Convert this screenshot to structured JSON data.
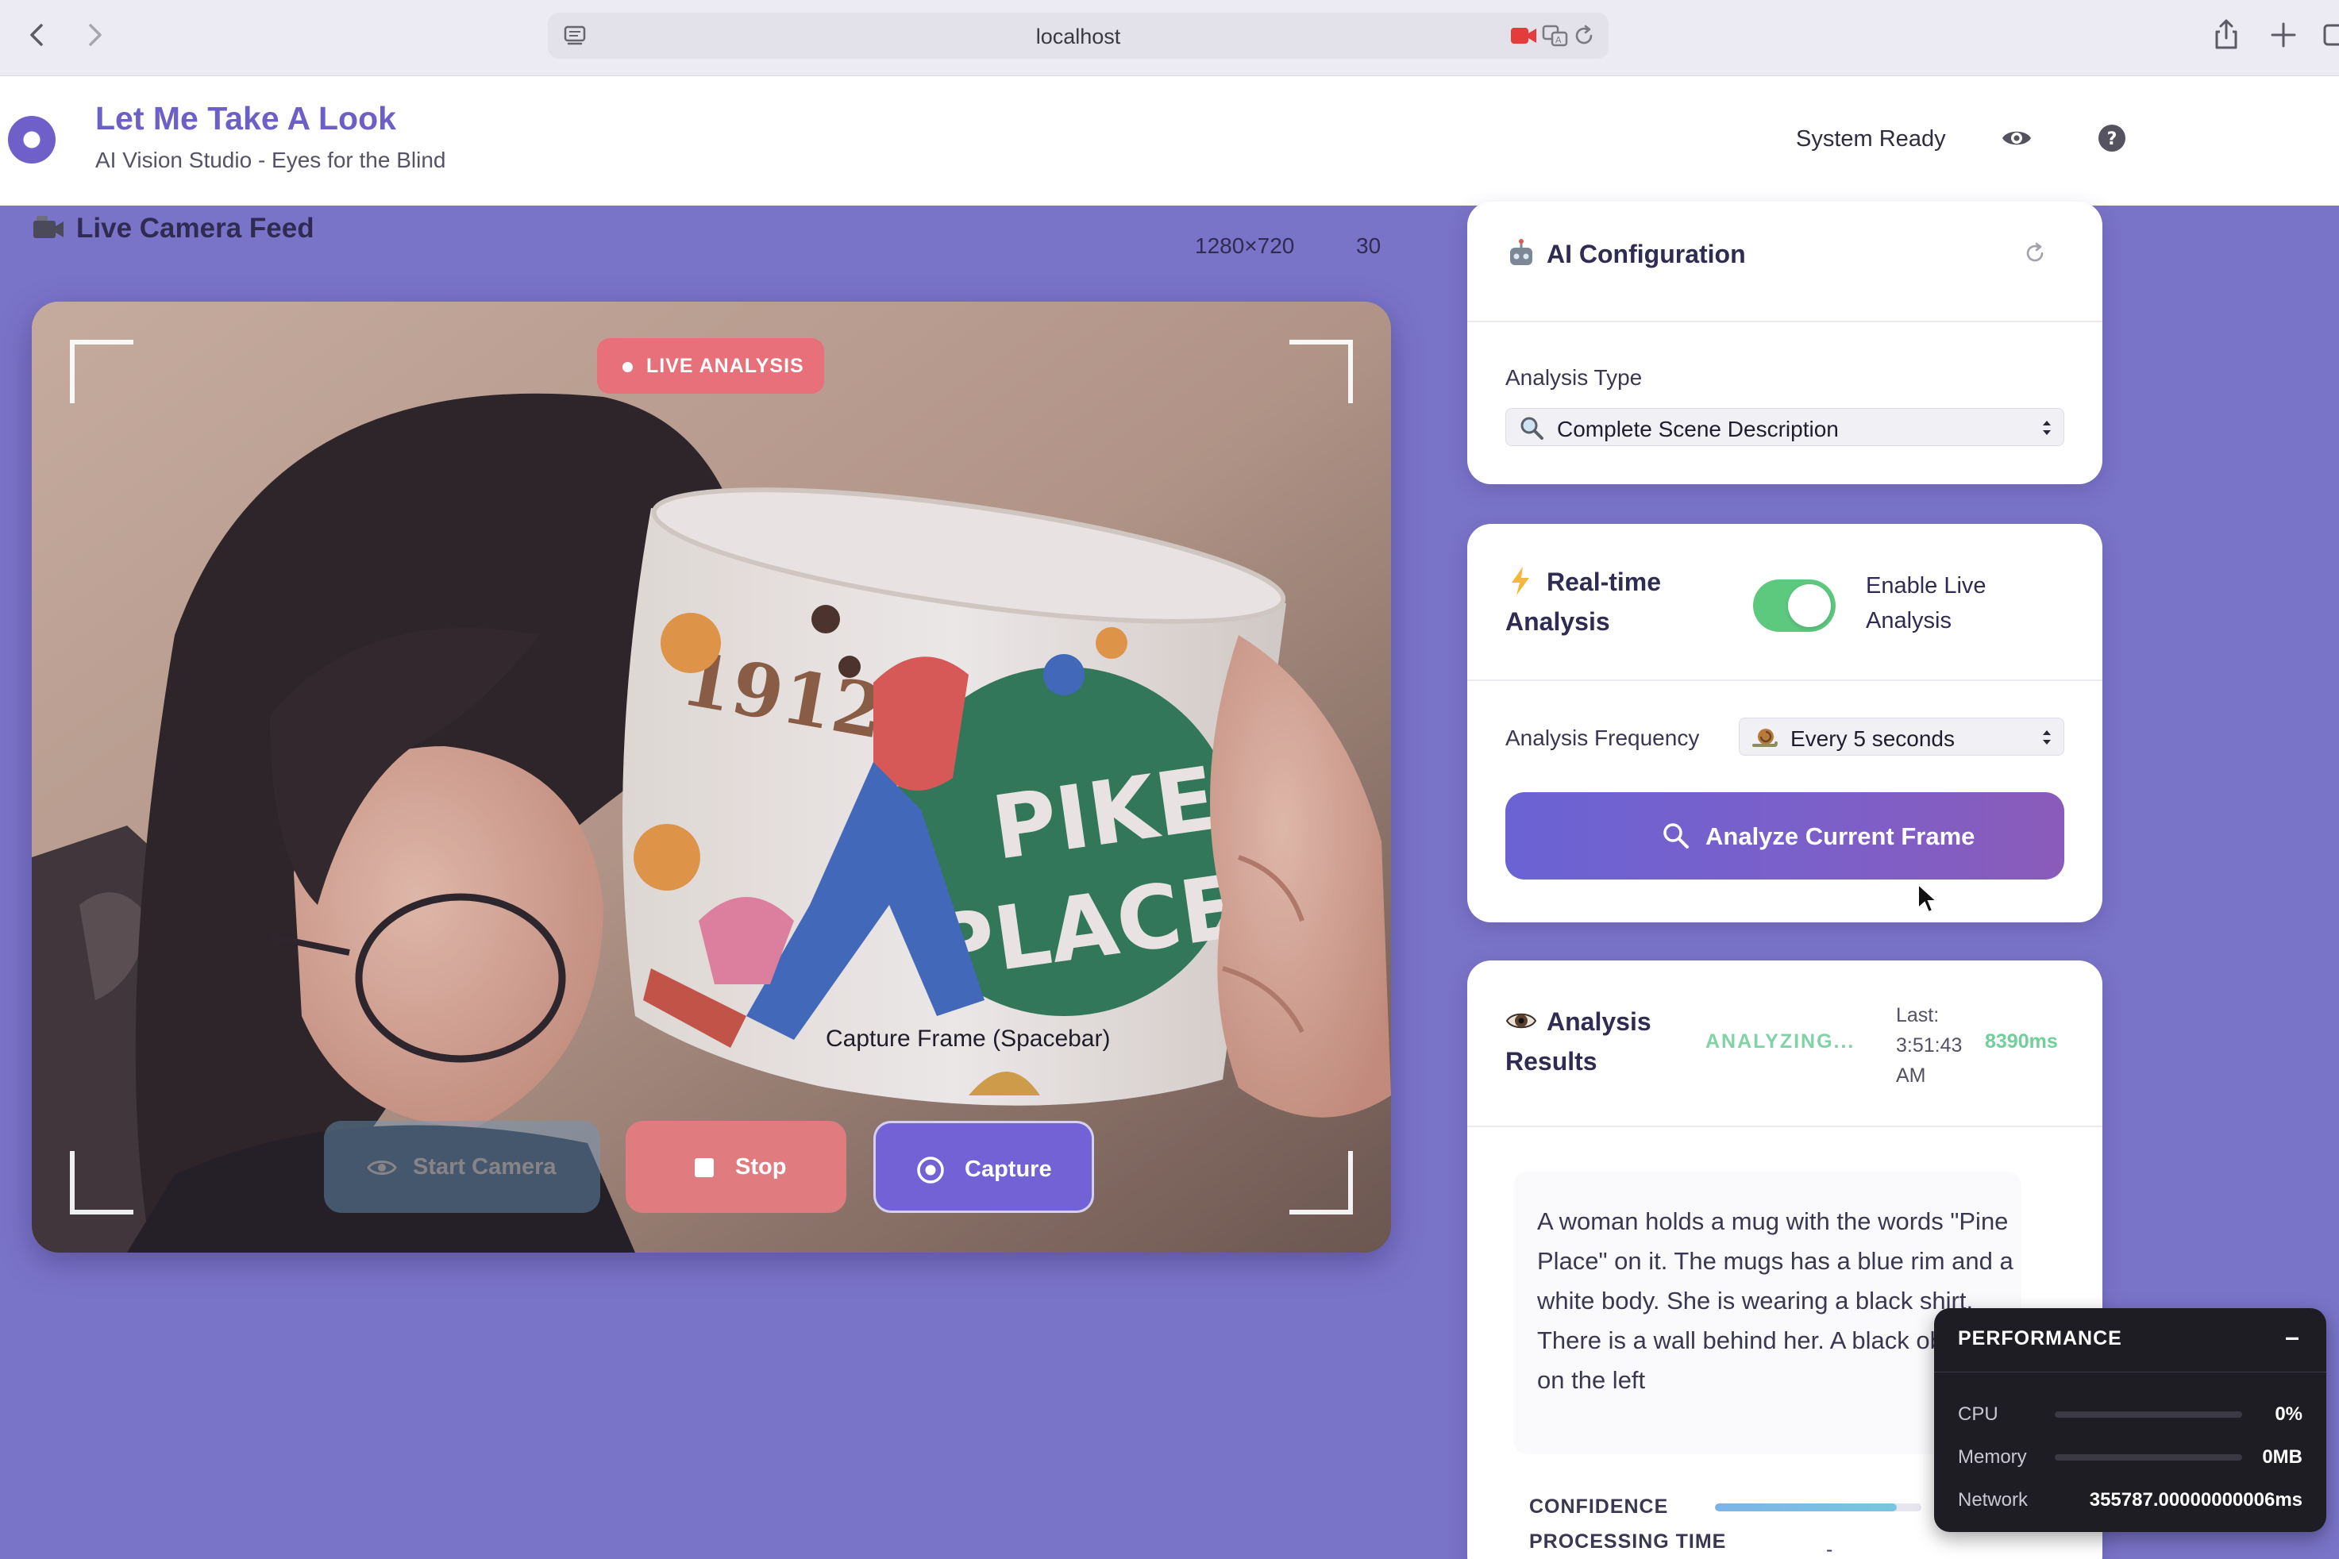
{
  "browser": {
    "url": "localhost"
  },
  "header": {
    "title": "Let Me Take A Look",
    "subtitle": "AI Vision Studio - Eyes for the Blind",
    "status": "System Ready"
  },
  "camera": {
    "title": "Live Camera Feed",
    "resolution": "1280×720",
    "fps": "30",
    "badge": "LIVE ANALYSIS",
    "capture_hint": "Capture Frame (Spacebar)",
    "buttons": {
      "start": "Start Camera",
      "stop": "Stop",
      "capture": "Capture"
    }
  },
  "ai_config": {
    "title": "AI Configuration",
    "analysis_type_label": "Analysis Type",
    "analysis_type_value": "Complete Scene Description"
  },
  "realtime": {
    "title": "Real-time Analysis",
    "toggle_label": "Enable Live Analysis",
    "toggle_on": true,
    "frequency_label": "Analysis Frequency",
    "frequency_value": "Every 5 seconds",
    "analyze_button": "Analyze Current Frame"
  },
  "results": {
    "title": "Analysis Results",
    "status": "ANALYZING...",
    "last_label": "Last: 3:51:43 AM",
    "latency": "8390ms",
    "description": "A woman holds a mug with the words \"Pine Place\" on it. The mugs has a blue rim and a white body. She is wearing a black shirt. There is a wall behind her. A black object is on the left",
    "confidence_label": "CONFIDENCE",
    "confidence_value": 0.88,
    "processing_time_label": "PROCESSING TIME",
    "processing_time_value": "-"
  },
  "performance": {
    "title": "PERFORMANCE",
    "minimize": "–",
    "cpu_label": "CPU",
    "cpu_value": "0%",
    "memory_label": "Memory",
    "memory_value": "0MB",
    "network_label": "Network",
    "network_value": "355787.00000000006ms"
  },
  "colors": {
    "page_bg": "#7a74c9",
    "accent": "#6c5fc7",
    "live_badge": "#e8707a",
    "stop_button": "#e07c80",
    "toggle_on": "#5dc97f",
    "analyzing": "#7fd3a5"
  },
  "icons": {
    "back": "chevron-left-icon",
    "forward": "chevron-right-icon",
    "camera_title": "video-camera-icon",
    "ai_config": "robot-icon",
    "refresh": "refresh-icon",
    "analysis_type": "magnifier-icon",
    "realtime": "lightning-icon",
    "frequency": "snail-icon",
    "results": "eye-icon"
  }
}
